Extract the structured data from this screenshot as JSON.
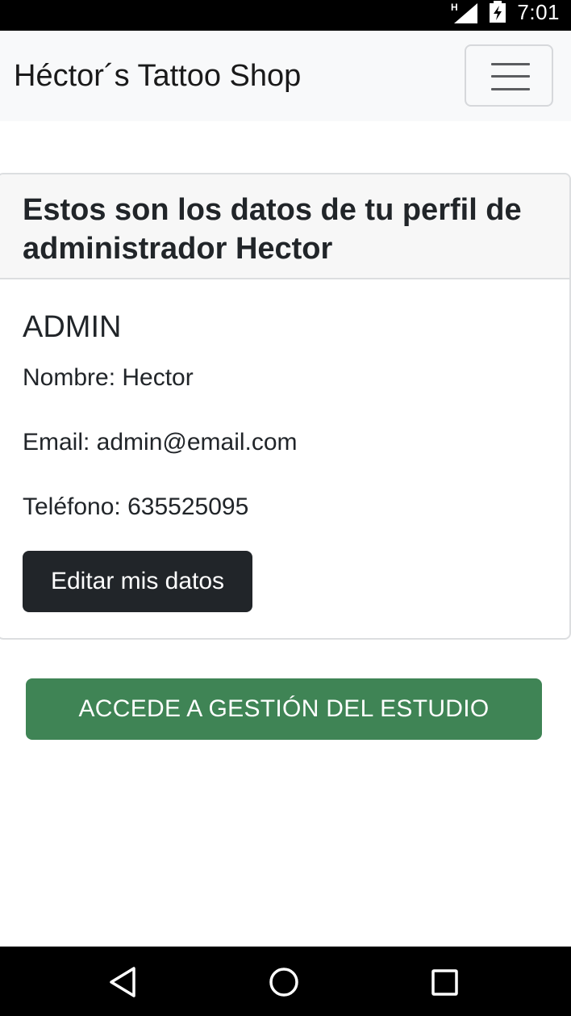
{
  "status_bar": {
    "network_label": "H",
    "time": "7:01",
    "icons": [
      "signal-icon",
      "battery-charging-icon"
    ]
  },
  "navbar": {
    "brand": "Héctor´s Tattoo Shop",
    "menu_icon": "hamburger-menu-icon"
  },
  "profile_card": {
    "header": "Estos son los datos de tu perfil de administrador Hector",
    "role": "ADMIN",
    "name_field": "Nombre: Hector",
    "email_field": "Email: admin@email.com",
    "phone_field": "Teléfono: 635525095",
    "edit_button": "Editar mis datos"
  },
  "manage_button": "ACCEDE A GESTIÓN DEL ESTUDIO",
  "colors": {
    "navbar_bg": "#f8f9fa",
    "dark_button": "#212529",
    "success_button": "#3f8455"
  },
  "system_nav": {
    "icons": [
      "back-icon",
      "home-icon",
      "recents-icon"
    ]
  }
}
